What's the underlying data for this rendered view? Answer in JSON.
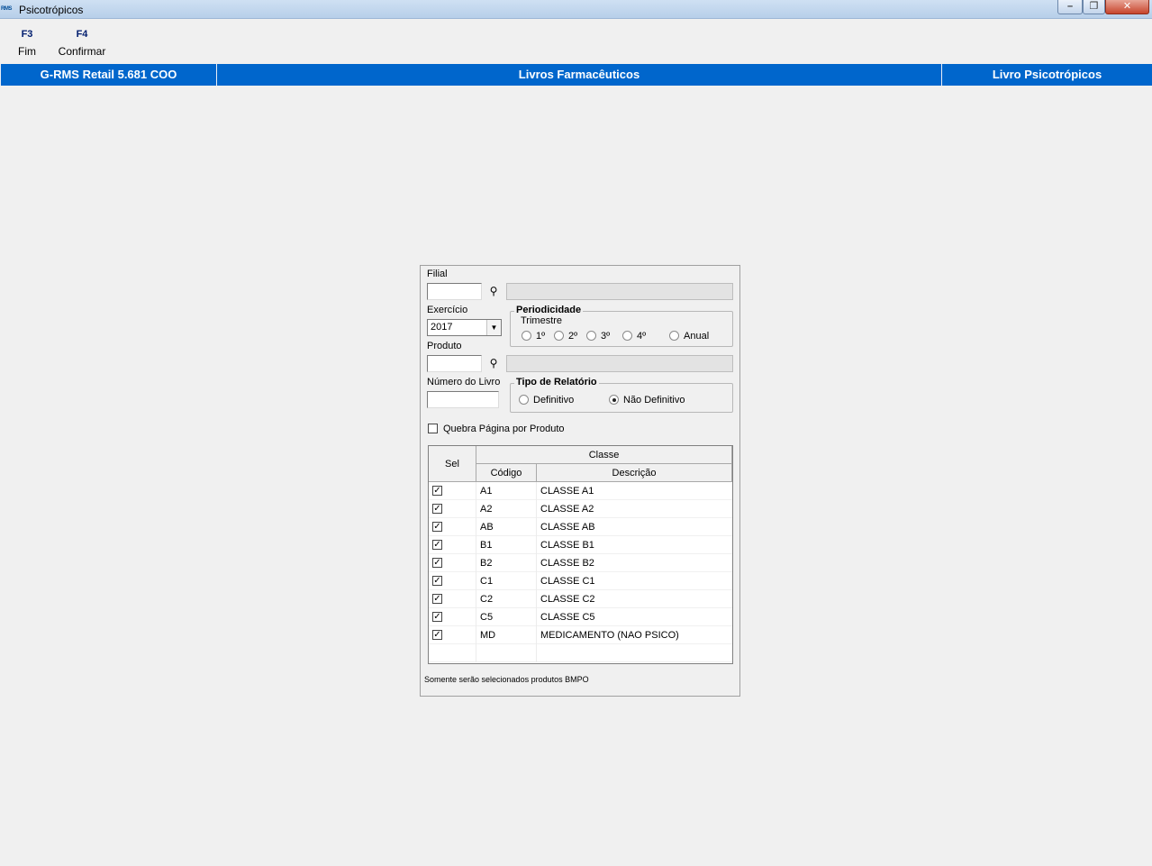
{
  "window": {
    "logo_text": "RMS",
    "title": "Psicotrópicos",
    "controls": {
      "minimize": "–",
      "maximize": "❐",
      "close": "✕"
    }
  },
  "toolbar": [
    {
      "key": "F3",
      "label": "Fim"
    },
    {
      "key": "F4",
      "label": "Confirmar"
    }
  ],
  "header": {
    "app": "G-RMS Retail 5.681 COO",
    "module": "Livros Farmacêuticos",
    "screen": "Livro Psicotrópicos",
    "color": "#0066cc"
  },
  "form": {
    "filial": {
      "label": "Filial",
      "value": "",
      "lookup_icon": "binoculars-icon",
      "description": ""
    },
    "exercicio": {
      "label": "Exercício",
      "value": "2017"
    },
    "periodicidade": {
      "title": "Periodicidade",
      "subtitle": "Trimestre",
      "options": [
        "1º",
        "2º",
        "3º",
        "4º",
        "Anual"
      ],
      "selected": null
    },
    "produto": {
      "label": "Produto",
      "value": "",
      "lookup_icon": "binoculars-icon",
      "description": ""
    },
    "numero_livro": {
      "label": "Número do Livro",
      "value": ""
    },
    "tipo_relatorio": {
      "title": "Tipo de Relatório",
      "options": [
        "Definitivo",
        "Não Definitivo"
      ],
      "selected": "Não Definitivo"
    },
    "quebra_pagina": {
      "label": "Quebra Página por Produto",
      "checked": false
    }
  },
  "grid": {
    "header_group": "Classe",
    "col_sel": "Sel",
    "col_codigo": "Código",
    "col_descricao": "Descrição",
    "rows": [
      {
        "sel": true,
        "codigo": "A1",
        "descricao": "CLASSE A1"
      },
      {
        "sel": true,
        "codigo": "A2",
        "descricao": "CLASSE A2"
      },
      {
        "sel": true,
        "codigo": "AB",
        "descricao": "CLASSE AB"
      },
      {
        "sel": true,
        "codigo": "B1",
        "descricao": "CLASSE B1"
      },
      {
        "sel": true,
        "codigo": "B2",
        "descricao": "CLASSE B2"
      },
      {
        "sel": true,
        "codigo": "C1",
        "descricao": "CLASSE C1"
      },
      {
        "sel": true,
        "codigo": "C2",
        "descricao": "CLASSE C2"
      },
      {
        "sel": true,
        "codigo": "C5",
        "descricao": "CLASSE C5"
      },
      {
        "sel": true,
        "codigo": "MD",
        "descricao": "MEDICAMENTO (NAO PSICO)"
      }
    ]
  },
  "footnote": "Somente serão selecionados produtos BMPO"
}
